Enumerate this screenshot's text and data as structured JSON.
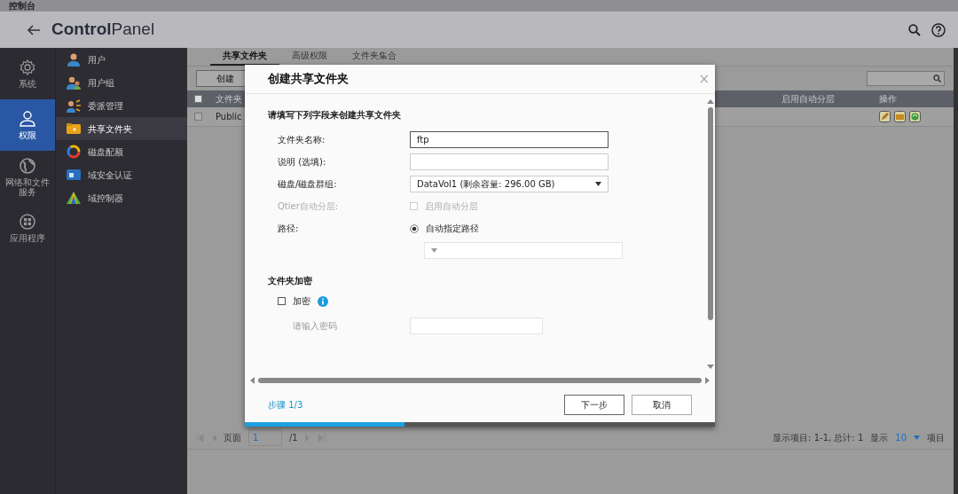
{
  "window": {
    "title": "控制台"
  },
  "header": {
    "title": "**Control**Panel"
  },
  "rail": [
    {
      "label": "系统",
      "kind": "gear",
      "selected": false
    },
    {
      "label": "权限",
      "kind": "person",
      "selected": true
    },
    {
      "label": "网络和文件服务",
      "kind": "globe",
      "selected": false
    },
    {
      "label": "应用程序",
      "kind": "apps",
      "selected": false
    }
  ],
  "menu": [
    {
      "label": "用户",
      "kind": "user",
      "selected": false
    },
    {
      "label": "用户组",
      "kind": "group",
      "selected": false
    },
    {
      "label": "委派管理",
      "kind": "delegate",
      "selected": false
    },
    {
      "label": "共享文件夹",
      "kind": "folder",
      "selected": true
    },
    {
      "label": "磁盘配额",
      "kind": "quota",
      "selected": false
    },
    {
      "label": "域安全认证",
      "kind": "domain",
      "selected": false
    },
    {
      "label": "域控制器",
      "kind": "controller",
      "selected": false
    }
  ],
  "tabs": [
    {
      "label": "共享文件夹",
      "selected": true
    },
    {
      "label": "高级权限",
      "selected": false
    },
    {
      "label": "文件夹集合",
      "selected": false
    }
  ],
  "toolbar": {
    "create": "创建"
  },
  "table": {
    "header_checked": false,
    "columns": [
      "文件夹",
      "启用自动分层",
      "操作"
    ],
    "rows": [
      {
        "checked": false,
        "name": "Public"
      }
    ]
  },
  "pager": {
    "page_label": "页面",
    "page": "1",
    "total_pages": "/1",
    "items_shown": "显示项目:  1-1, 总计:  1",
    "show": "显示",
    "per_page": "10",
    "items": "项目"
  },
  "dialog": {
    "title": "创建共享文件夹",
    "close": "×",
    "heading": "请填写下列字段来创建共享文件夹",
    "fields": [
      {
        "kind": "text",
        "label": "文件夹名称:",
        "value": "ftp"
      },
      {
        "kind": "text",
        "label": "说明 (选填):"
      },
      {
        "kind": "select",
        "label": "磁盘/磁盘群组:",
        "value": "DataVol1 (剩余容量:  296.00 GB)"
      },
      {
        "kind": "checkbox",
        "label": "Qtier自动分层:",
        "option": "启用自动分层",
        "checked": false,
        "disabled": true
      },
      {
        "kind": "radio",
        "label": "路径:",
        "option": "自动指定路径",
        "selected": true
      },
      {
        "kind": "select"
      }
    ],
    "section": "文件夹加密",
    "encrypt": {
      "label": "加密",
      "checked": false
    },
    "password": {
      "label": "请输入密码"
    },
    "step": "步骤 1/3",
    "next": "下一步",
    "cancel": "取消",
    "progress": {
      "level": 0.34
    }
  }
}
